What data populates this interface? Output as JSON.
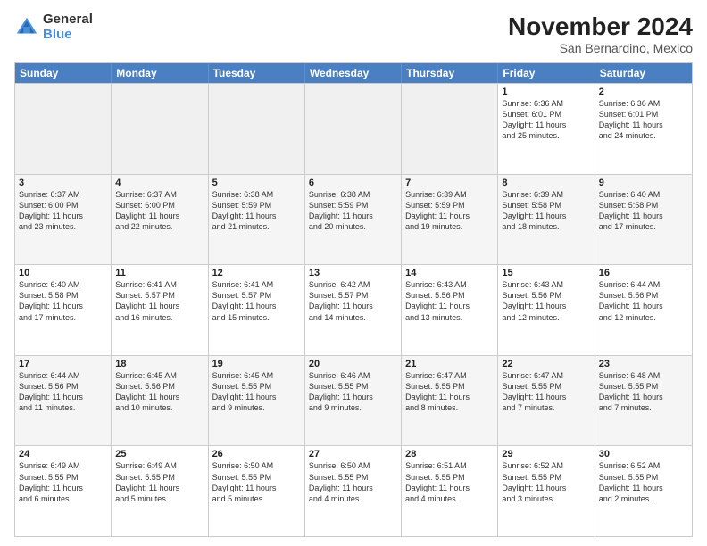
{
  "logo": {
    "general": "General",
    "blue": "Blue"
  },
  "title": "November 2024",
  "subtitle": "San Bernardino, Mexico",
  "days": [
    "Sunday",
    "Monday",
    "Tuesday",
    "Wednesday",
    "Thursday",
    "Friday",
    "Saturday"
  ],
  "weeks": [
    {
      "alt": false,
      "cells": [
        {
          "num": "",
          "empty": true,
          "info": ""
        },
        {
          "num": "",
          "empty": true,
          "info": ""
        },
        {
          "num": "",
          "empty": true,
          "info": ""
        },
        {
          "num": "",
          "empty": true,
          "info": ""
        },
        {
          "num": "",
          "empty": true,
          "info": ""
        },
        {
          "num": "1",
          "empty": false,
          "info": "Sunrise: 6:36 AM\nSunset: 6:01 PM\nDaylight: 11 hours\nand 25 minutes."
        },
        {
          "num": "2",
          "empty": false,
          "info": "Sunrise: 6:36 AM\nSunset: 6:01 PM\nDaylight: 11 hours\nand 24 minutes."
        }
      ]
    },
    {
      "alt": true,
      "cells": [
        {
          "num": "3",
          "empty": false,
          "info": "Sunrise: 6:37 AM\nSunset: 6:00 PM\nDaylight: 11 hours\nand 23 minutes."
        },
        {
          "num": "4",
          "empty": false,
          "info": "Sunrise: 6:37 AM\nSunset: 6:00 PM\nDaylight: 11 hours\nand 22 minutes."
        },
        {
          "num": "5",
          "empty": false,
          "info": "Sunrise: 6:38 AM\nSunset: 5:59 PM\nDaylight: 11 hours\nand 21 minutes."
        },
        {
          "num": "6",
          "empty": false,
          "info": "Sunrise: 6:38 AM\nSunset: 5:59 PM\nDaylight: 11 hours\nand 20 minutes."
        },
        {
          "num": "7",
          "empty": false,
          "info": "Sunrise: 6:39 AM\nSunset: 5:59 PM\nDaylight: 11 hours\nand 19 minutes."
        },
        {
          "num": "8",
          "empty": false,
          "info": "Sunrise: 6:39 AM\nSunset: 5:58 PM\nDaylight: 11 hours\nand 18 minutes."
        },
        {
          "num": "9",
          "empty": false,
          "info": "Sunrise: 6:40 AM\nSunset: 5:58 PM\nDaylight: 11 hours\nand 17 minutes."
        }
      ]
    },
    {
      "alt": false,
      "cells": [
        {
          "num": "10",
          "empty": false,
          "info": "Sunrise: 6:40 AM\nSunset: 5:58 PM\nDaylight: 11 hours\nand 17 minutes."
        },
        {
          "num": "11",
          "empty": false,
          "info": "Sunrise: 6:41 AM\nSunset: 5:57 PM\nDaylight: 11 hours\nand 16 minutes."
        },
        {
          "num": "12",
          "empty": false,
          "info": "Sunrise: 6:41 AM\nSunset: 5:57 PM\nDaylight: 11 hours\nand 15 minutes."
        },
        {
          "num": "13",
          "empty": false,
          "info": "Sunrise: 6:42 AM\nSunset: 5:57 PM\nDaylight: 11 hours\nand 14 minutes."
        },
        {
          "num": "14",
          "empty": false,
          "info": "Sunrise: 6:43 AM\nSunset: 5:56 PM\nDaylight: 11 hours\nand 13 minutes."
        },
        {
          "num": "15",
          "empty": false,
          "info": "Sunrise: 6:43 AM\nSunset: 5:56 PM\nDaylight: 11 hours\nand 12 minutes."
        },
        {
          "num": "16",
          "empty": false,
          "info": "Sunrise: 6:44 AM\nSunset: 5:56 PM\nDaylight: 11 hours\nand 12 minutes."
        }
      ]
    },
    {
      "alt": true,
      "cells": [
        {
          "num": "17",
          "empty": false,
          "info": "Sunrise: 6:44 AM\nSunset: 5:56 PM\nDaylight: 11 hours\nand 11 minutes."
        },
        {
          "num": "18",
          "empty": false,
          "info": "Sunrise: 6:45 AM\nSunset: 5:56 PM\nDaylight: 11 hours\nand 10 minutes."
        },
        {
          "num": "19",
          "empty": false,
          "info": "Sunrise: 6:45 AM\nSunset: 5:55 PM\nDaylight: 11 hours\nand 9 minutes."
        },
        {
          "num": "20",
          "empty": false,
          "info": "Sunrise: 6:46 AM\nSunset: 5:55 PM\nDaylight: 11 hours\nand 9 minutes."
        },
        {
          "num": "21",
          "empty": false,
          "info": "Sunrise: 6:47 AM\nSunset: 5:55 PM\nDaylight: 11 hours\nand 8 minutes."
        },
        {
          "num": "22",
          "empty": false,
          "info": "Sunrise: 6:47 AM\nSunset: 5:55 PM\nDaylight: 11 hours\nand 7 minutes."
        },
        {
          "num": "23",
          "empty": false,
          "info": "Sunrise: 6:48 AM\nSunset: 5:55 PM\nDaylight: 11 hours\nand 7 minutes."
        }
      ]
    },
    {
      "alt": false,
      "cells": [
        {
          "num": "24",
          "empty": false,
          "info": "Sunrise: 6:49 AM\nSunset: 5:55 PM\nDaylight: 11 hours\nand 6 minutes."
        },
        {
          "num": "25",
          "empty": false,
          "info": "Sunrise: 6:49 AM\nSunset: 5:55 PM\nDaylight: 11 hours\nand 5 minutes."
        },
        {
          "num": "26",
          "empty": false,
          "info": "Sunrise: 6:50 AM\nSunset: 5:55 PM\nDaylight: 11 hours\nand 5 minutes."
        },
        {
          "num": "27",
          "empty": false,
          "info": "Sunrise: 6:50 AM\nSunset: 5:55 PM\nDaylight: 11 hours\nand 4 minutes."
        },
        {
          "num": "28",
          "empty": false,
          "info": "Sunrise: 6:51 AM\nSunset: 5:55 PM\nDaylight: 11 hours\nand 4 minutes."
        },
        {
          "num": "29",
          "empty": false,
          "info": "Sunrise: 6:52 AM\nSunset: 5:55 PM\nDaylight: 11 hours\nand 3 minutes."
        },
        {
          "num": "30",
          "empty": false,
          "info": "Sunrise: 6:52 AM\nSunset: 5:55 PM\nDaylight: 11 hours\nand 2 minutes."
        }
      ]
    }
  ]
}
